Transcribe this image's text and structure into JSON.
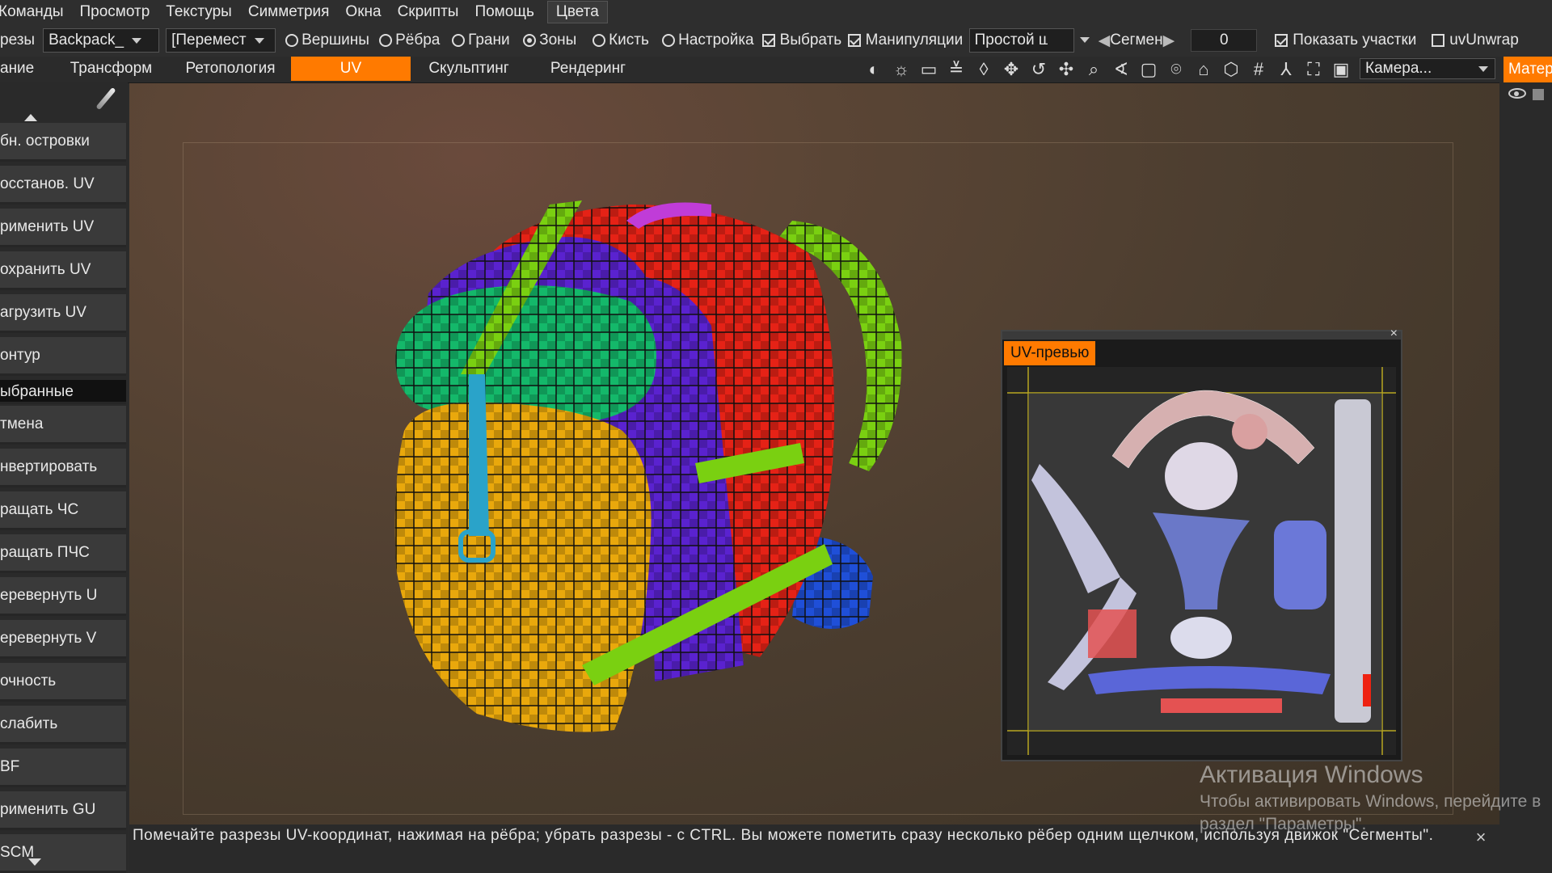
{
  "menu": [
    "Команды",
    "Просмотр",
    "Текстуры",
    "Симметрия",
    "Окна",
    "Скрипты",
    "Помощь",
    "Цвета"
  ],
  "toolbar": {
    "left_label": "резы",
    "object_select": "Backpack_",
    "tool_select": "[Перемест",
    "modes": [
      {
        "label": "Вершины",
        "checked": false
      },
      {
        "label": "Рёбра",
        "checked": false
      },
      {
        "label": "Грани",
        "checked": false
      },
      {
        "label": "Зоны",
        "checked": true
      },
      {
        "label": "Кисть",
        "checked": false
      },
      {
        "label": "Настройка",
        "checked": false
      }
    ],
    "select_label": "Выбрать",
    "manip_label": "Манипуляции",
    "mode_select": "Простой ш",
    "segments_label": "Сегмен",
    "segments_value": "0",
    "show_label": "Показать участки",
    "uvunwrap_label": "uvUnwrap"
  },
  "tabs": [
    "ание",
    "Трансформ",
    "Ретопология",
    "UV",
    "Скульптинг",
    "Рендеринг"
  ],
  "active_tab": "UV",
  "camera_select": "Камера...",
  "materials_tab": "Матер",
  "sidebar": [
    "бн. островки",
    "осстанов. UV",
    "рименить UV",
    "охранить UV",
    "агрузить UV",
    "онтур",
    "ыбранные",
    "тмена",
    "нвертировать",
    "ращать ЧС",
    "ращать ПЧС",
    "еревернуть U",
    "еревернуть V",
    "очность",
    "слабить",
    "BF",
    "рименить GU",
    "SCM"
  ],
  "sidebar_selected": "ыбранные",
  "uv_preview": {
    "title": "UV-превью"
  },
  "status_text": "Помечайте разрезы UV-координат, нажимая на рёбра; убрать разрезы - с CTRL. Вы можете пометить сразу несколько рёбер одним щелчком, используя движок \"Сегменты\".",
  "watermark": {
    "line1": "Активация Windows",
    "line2": "Чтобы активировать Windows, перейдите в",
    "line3": "раздел \"Параметры\"."
  },
  "colors": {
    "accent": "#ff7a00",
    "panel": "#2e2e2e",
    "button": "#3a3a3a"
  }
}
